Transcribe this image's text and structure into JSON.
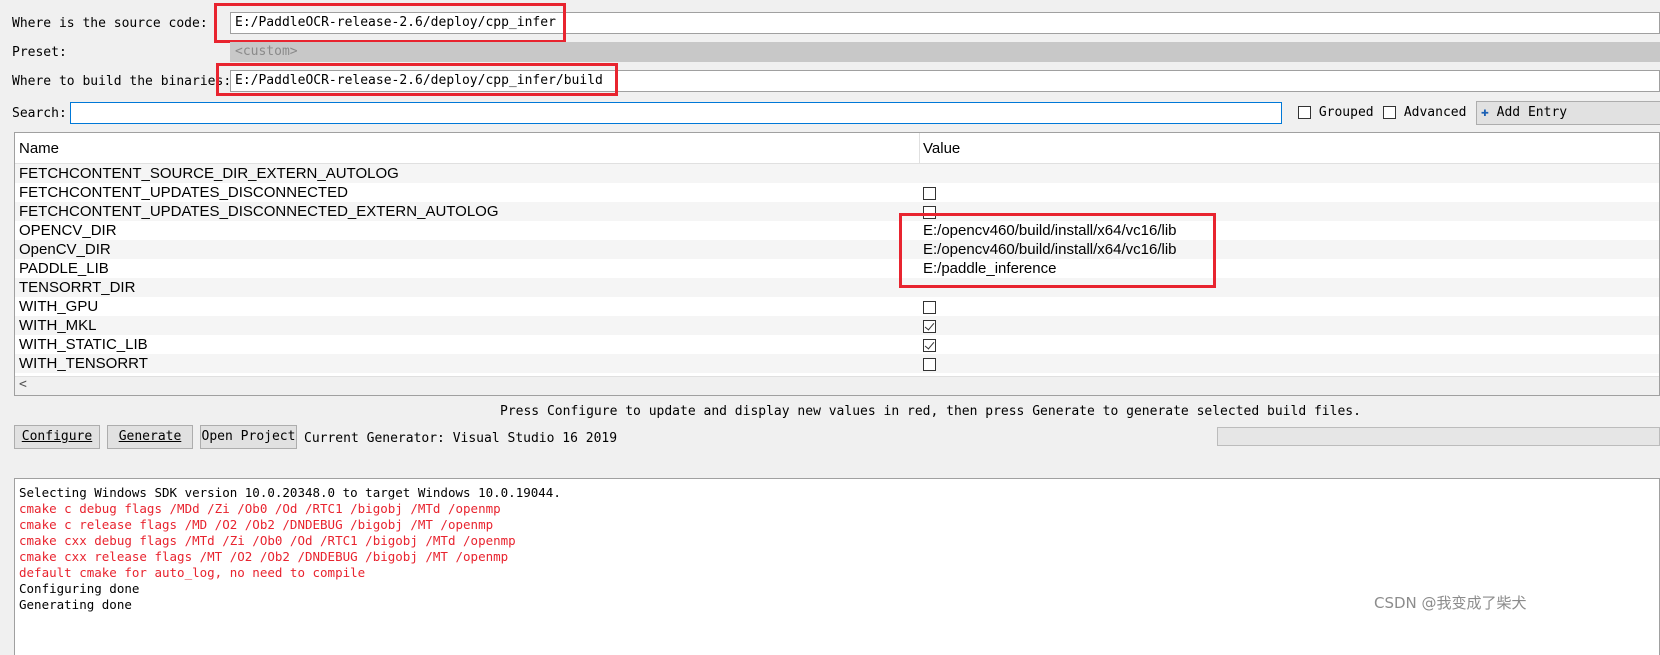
{
  "source": {
    "label": "Where is the source code:",
    "value": "E:/PaddleOCR-release-2.6/deploy/cpp_infer"
  },
  "preset": {
    "label": "Preset:",
    "value": "<custom>"
  },
  "build": {
    "label": "Where to build the binaries:",
    "value": "E:/PaddleOCR-release-2.6/deploy/cpp_infer/build"
  },
  "search": {
    "label": "Search:",
    "value": ""
  },
  "options": {
    "grouped": "Grouped",
    "advanced": "Advanced",
    "add_entry": "Add Entry"
  },
  "table": {
    "headers": {
      "name": "Name",
      "value": "Value"
    },
    "rows": [
      {
        "name": "FETCHCONTENT_SOURCE_DIR_EXTERN_AUTOLOG",
        "type": "text",
        "value": ""
      },
      {
        "name": "FETCHCONTENT_UPDATES_DISCONNECTED",
        "type": "bool",
        "checked": false
      },
      {
        "name": "FETCHCONTENT_UPDATES_DISCONNECTED_EXTERN_AUTOLOG",
        "type": "bool",
        "checked": false
      },
      {
        "name": "OPENCV_DIR",
        "type": "text",
        "value": "E:/opencv460/build/install/x64/vc16/lib"
      },
      {
        "name": "OpenCV_DIR",
        "type": "text",
        "value": "E:/opencv460/build/install/x64/vc16/lib"
      },
      {
        "name": "PADDLE_LIB",
        "type": "text",
        "value": "E:/paddle_inference"
      },
      {
        "name": "TENSORRT_DIR",
        "type": "text",
        "value": ""
      },
      {
        "name": "WITH_GPU",
        "type": "bool",
        "checked": false
      },
      {
        "name": "WITH_MKL",
        "type": "bool",
        "checked": true
      },
      {
        "name": "WITH_STATIC_LIB",
        "type": "bool",
        "checked": true
      },
      {
        "name": "WITH_TENSORRT",
        "type": "bool",
        "checked": false
      }
    ]
  },
  "hint": "Press Configure to update and display new values in red, then press Generate to generate selected build files.",
  "buttons": {
    "configure": "Configure",
    "generate": "Generate",
    "open_project": "Open Project"
  },
  "generator": "Current Generator: Visual Studio 16 2019",
  "log": [
    {
      "text": "Selecting Windows SDK version 10.0.20348.0 to target Windows 10.0.19044.",
      "color": "#000000"
    },
    {
      "text": "cmake c debug flags /MDd /Zi /Ob0 /Od /RTC1 /bigobj /MTd /openmp",
      "color": "#e8242f"
    },
    {
      "text": "cmake c release flags /MD /O2 /Ob2 /DNDEBUG /bigobj /MT /openmp",
      "color": "#e8242f"
    },
    {
      "text": "cmake cxx debug flags /MTd /Zi /Ob0 /Od /RTC1 /bigobj /MTd /openmp",
      "color": "#e8242f"
    },
    {
      "text": "cmake cxx release flags /MT /O2 /Ob2 /DNDEBUG /bigobj /MT /openmp",
      "color": "#e8242f"
    },
    {
      "text": "default cmake for auto_log, no need to compile",
      "color": "#e8242f"
    },
    {
      "text": "Configuring done",
      "color": "#000000"
    },
    {
      "text": "Generating done",
      "color": "#000000"
    }
  ],
  "watermark": "CSDN @我变成了柴犬",
  "colors": {
    "highlight": "#e8242f",
    "search_border": "#0078d7"
  }
}
